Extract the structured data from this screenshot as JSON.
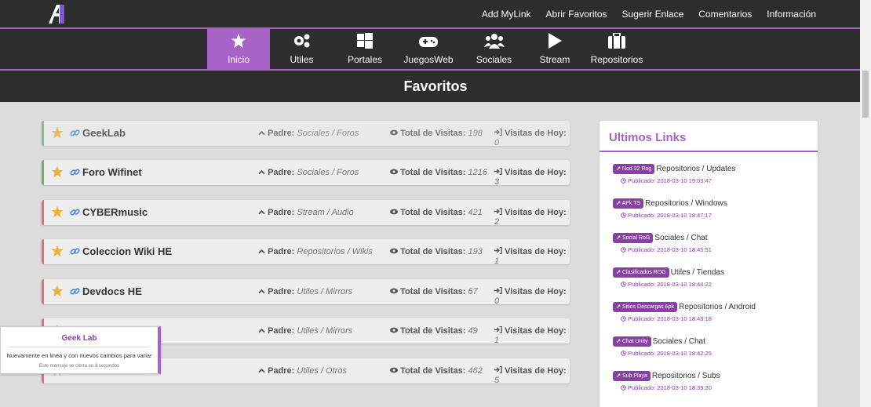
{
  "topnav": [
    "Add MyLink",
    "Abrir Favoritos",
    "Sugerir Enlace",
    "Comentarios",
    "Información"
  ],
  "categories": [
    {
      "label": "Inicio",
      "icon": "star-icon",
      "active": true
    },
    {
      "label": "Utiles",
      "icon": "gears-icon"
    },
    {
      "label": "Portales",
      "icon": "windows-icon"
    },
    {
      "label": "JuegosWeb",
      "icon": "gamepad-icon"
    },
    {
      "label": "Sociales",
      "icon": "users-icon"
    },
    {
      "label": "Stream",
      "icon": "play-icon"
    },
    {
      "label": "Repositorios",
      "icon": "briefcase-icon"
    }
  ],
  "page_title": "Favoritos",
  "labels": {
    "padre": "Padre:",
    "total": "Total de Visitas:",
    "hoy": "Visitas de Hoy:"
  },
  "favorites": [
    {
      "name": "GeekLab",
      "padre": "Sociales / Foros",
      "total": "198",
      "hoy": "0",
      "accent": "#6ab06a"
    },
    {
      "name": "Foro Wifinet",
      "padre": "Sociales / Foros",
      "total": "1216",
      "hoy": "3",
      "accent": "#6ab06a"
    },
    {
      "name": "CYBERmusic",
      "padre": "Stream / Audio",
      "total": "421",
      "hoy": "2",
      "accent": "#e07070"
    },
    {
      "name": "Coleccion Wiki HE",
      "padre": "Repositorios / Wikis",
      "total": "193",
      "hoy": "1",
      "accent": "#e07070"
    },
    {
      "name": "Devdocs HE",
      "padre": "Utiles / Mirrors",
      "total": "67",
      "hoy": "0",
      "accent": "#e07070"
    },
    {
      "name": "",
      "padre": "Utiles / Mirrors",
      "total": "49",
      "hoy": "1",
      "accent": "#e07070"
    },
    {
      "name": "",
      "padre": "Utiles / Otros",
      "total": "462",
      "hoy": "5",
      "accent": "#e07070"
    }
  ],
  "panel": {
    "title": "Ultimos Links",
    "published_label": "Publicado:",
    "links": [
      {
        "badge": "Nod 32 Rog",
        "path": "Repositorios / Updates",
        "date": "2018-03-10 19:03:47"
      },
      {
        "badge": "APk TS",
        "path": "Repositorios / Windows",
        "date": "2018-03-10 18:47:17"
      },
      {
        "badge": "Social RoG",
        "path": "Sociales / Chat",
        "date": "2018-03-10 18:45:51"
      },
      {
        "badge": "Clasificados ROG",
        "path": "Utiles / Tiendas",
        "date": "2018-03-10 18:44:22"
      },
      {
        "badge": "Sitios Descargas Apk",
        "path": "Repositorios / Android",
        "date": "2018-03-10 18:43:18"
      },
      {
        "badge": "Chat Unity",
        "path": "Sociales / Chat",
        "date": "2018-03-10 18:42:25"
      },
      {
        "badge": "Sub Playa",
        "path": "Repositorios / Subs",
        "date": "2018-03-10 18:39:20"
      }
    ]
  },
  "toast": {
    "title": "Geek Lab",
    "message": "Nuevamente en linea y con nuevos cambios para variar",
    "sub": "Este mensaje se cierra en 8 segundos"
  },
  "colors": {
    "accent": "#a862c8",
    "dark": "#2d2d2d",
    "star": "#f0b13a",
    "link_icon": "#4a90d9"
  }
}
